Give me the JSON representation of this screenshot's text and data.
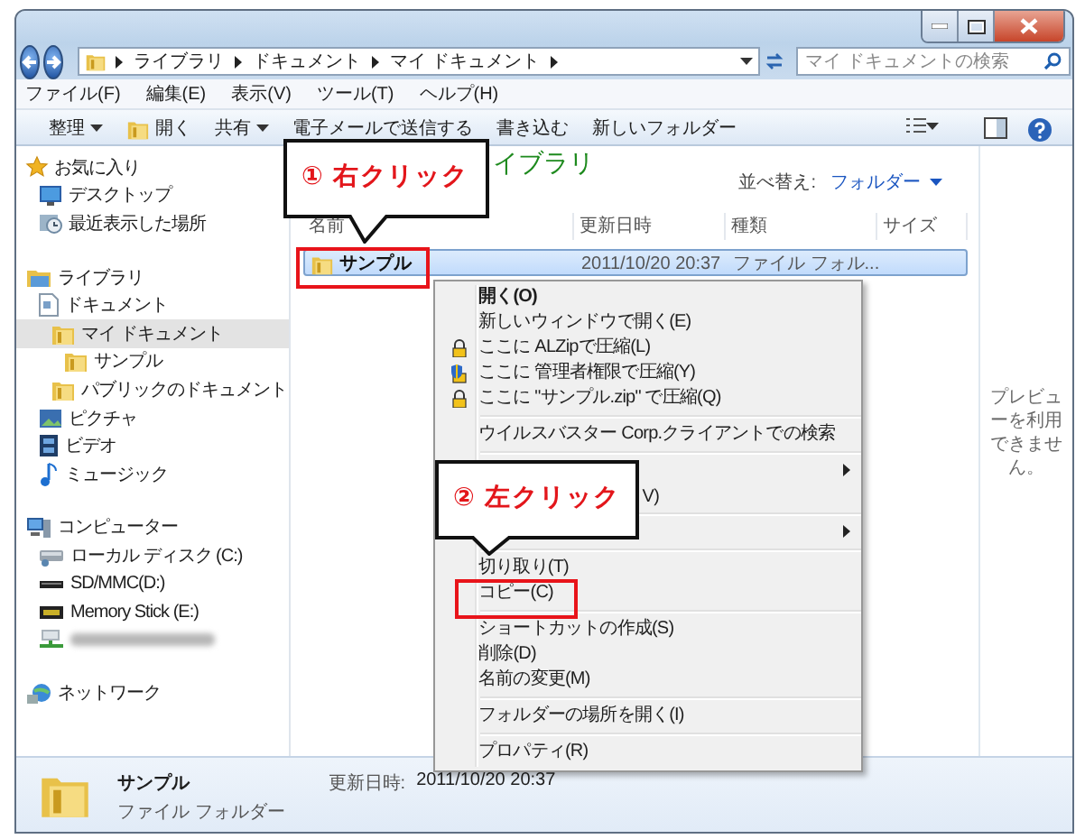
{
  "address_bar": {
    "path": [
      "ライブラリ",
      "ドキュメント",
      "マイ ドキュメント"
    ]
  },
  "search": {
    "placeholder": "マイ ドキュメントの検索"
  },
  "menu_bar": [
    "ファイル(F)",
    "編集(E)",
    "表示(V)",
    "ツール(T)",
    "ヘルプ(H)"
  ],
  "toolbar": [
    {
      "label": "整理",
      "kind": "dropdown"
    },
    {
      "label": "開く",
      "kind": "icon"
    },
    {
      "label": "共有",
      "kind": "dropdown"
    },
    {
      "label": "電子メールで送信する",
      "kind": "plain"
    },
    {
      "label": "書き込む",
      "kind": "plain"
    },
    {
      "label": "新しいフォルダー",
      "kind": "plain"
    }
  ],
  "sidebar": {
    "sections": [
      {
        "label": "お気に入り",
        "kind": "star",
        "selected": false,
        "children": [
          {
            "label": "デスクトップ",
            "kind": "desktop",
            "selected": false
          },
          {
            "label": "最近表示した場所",
            "kind": "recent",
            "selected": false
          }
        ]
      },
      {
        "label": "ライブラリ",
        "kind": "library",
        "selected": false,
        "children": [
          {
            "label": "ドキュメント",
            "kind": "document",
            "selected": false,
            "children": [
              {
                "label": "マイ ドキュメント",
                "kind": "folder",
                "selected": true,
                "children": [
                  {
                    "label": "サンプル",
                    "kind": "folder",
                    "selected": false
                  }
                ]
              },
              {
                "label": "パブリックのドキュメント",
                "kind": "folder",
                "selected": false
              }
            ]
          },
          {
            "label": "ピクチャ",
            "kind": "picture",
            "selected": false
          },
          {
            "label": "ビデオ",
            "kind": "video",
            "selected": false
          },
          {
            "label": "ミュージック",
            "kind": "music",
            "selected": false
          }
        ]
      },
      {
        "label": "コンピューター",
        "kind": "computer",
        "selected": false,
        "children": [
          {
            "label": "ローカル ディスク (C:)",
            "kind": "disk",
            "selected": false
          },
          {
            "label": "SD/MMC(D:)",
            "kind": "card",
            "selected": false
          },
          {
            "label": "Memory Stick (E:)",
            "kind": "stick",
            "selected": false
          },
          {
            "kind": "blurred",
            "selected": false
          }
        ]
      },
      {
        "label": "ネットワーク",
        "kind": "network",
        "selected": false
      }
    ]
  },
  "library": {
    "title": "イブラリ",
    "sort_label": "並べ替え:",
    "sort_value": "フォルダー"
  },
  "table": {
    "columns": [
      "名前",
      "更新日時",
      "種類",
      "サイズ"
    ],
    "rows": [
      {
        "name": "サンプル",
        "modified": "2011/10/20 20:37",
        "type": "ファイル フォル...",
        "selected": true
      }
    ]
  },
  "preview": {
    "text": "プレビューを利用できません。"
  },
  "context_menu": [
    {
      "kind": "command",
      "label": "開く(O)",
      "default": true
    },
    {
      "kind": "command",
      "label": "新しいウィンドウで開く(E)",
      "default": false
    },
    {
      "kind": "zip",
      "label": "ここに ALZipで圧縮(L)",
      "default": false
    },
    {
      "kind": "admin",
      "label": "ここに 管理者権限で圧縮(Y)",
      "default": false
    },
    {
      "kind": "zip",
      "label": "ここに \"サンプル.zip\" で圧縮(Q)",
      "default": false
    },
    {
      "kind": "separator"
    },
    {
      "kind": "command",
      "label": "ウイルスバスター Corp.クライアントでの検索",
      "default": false
    },
    {
      "kind": "separator"
    },
    {
      "kind": "submenu"
    },
    {
      "kind": "covered",
      "label": "V)"
    },
    {
      "kind": "separator"
    },
    {
      "kind": "submenu"
    },
    {
      "kind": "separator"
    },
    {
      "kind": "command",
      "label": "切り取り(T)",
      "default": false
    },
    {
      "kind": "command",
      "label": "コピー(C)",
      "default": false
    },
    {
      "kind": "separator"
    },
    {
      "kind": "command",
      "label": "ショートカットの作成(S)",
      "default": false
    },
    {
      "kind": "command",
      "label": "削除(D)",
      "default": false
    },
    {
      "kind": "command",
      "label": "名前の変更(M)",
      "default": false
    },
    {
      "kind": "separator"
    },
    {
      "kind": "command",
      "label": "フォルダーの場所を開く(I)",
      "default": false
    },
    {
      "kind": "separator"
    },
    {
      "kind": "command",
      "label": "プロパティ(R)",
      "default": false
    }
  ],
  "callouts": [
    "① 右クリック",
    "② 左クリック"
  ],
  "details": {
    "name": "サンプル",
    "type": "ファイル フォルダー",
    "modified_label": "更新日時:",
    "modified": "2011/10/20 20:37"
  }
}
